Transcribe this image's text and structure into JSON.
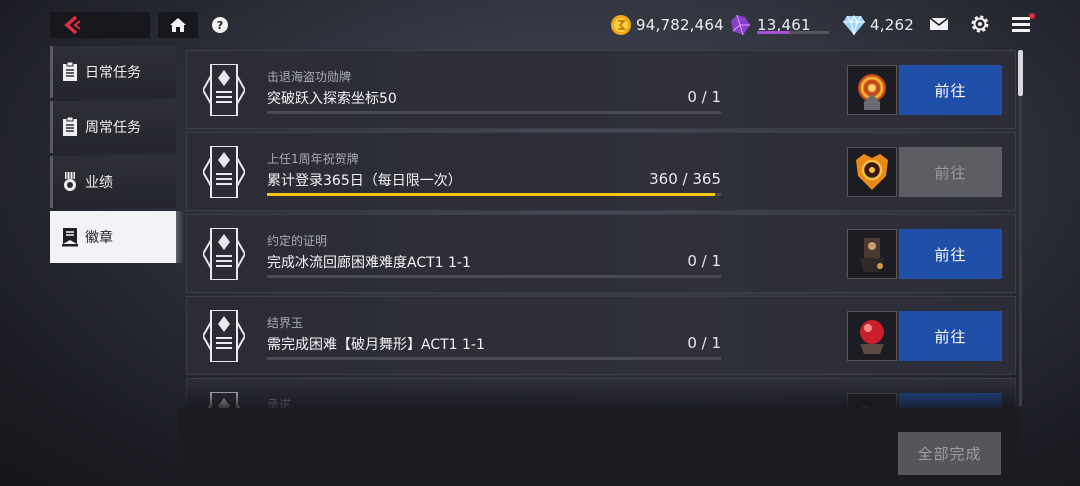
{
  "colors": {
    "accent_blue": "#1f4fa8",
    "progress_yellow": "#f5c518",
    "back_red": "#e03040",
    "purple": "#a44fd6",
    "disabled": "#5d5e64"
  },
  "topbar": {
    "back_icon": "back-chevron-icon",
    "home_icon": "home-icon",
    "help_icon": "help-icon",
    "help_glyph": "?",
    "gold": {
      "icon": "gold-coin-icon",
      "value": "94,782,464"
    },
    "purple": {
      "icon": "purple-crystal-icon",
      "value": "13,461",
      "progress": 0.45
    },
    "diamond": {
      "icon": "diamond-icon",
      "value": "4,262"
    },
    "mail_icon": "mail-icon",
    "settings_icon": "gear-icon",
    "menu_icon": "menu-icon"
  },
  "sidebar": {
    "items": [
      {
        "label": "日常任务",
        "icon": "clipboard-icon",
        "active": false
      },
      {
        "label": "周常任务",
        "icon": "clipboard-icon",
        "active": false
      },
      {
        "label": "业绩",
        "icon": "medal-icon",
        "active": false
      },
      {
        "label": "徽章",
        "icon": "badge-icon",
        "active": true
      }
    ]
  },
  "tasks": [
    {
      "category": "击退海盗功勋牌",
      "description": "突破跃入探索坐标50",
      "progress": "0 / 1",
      "fraction": 0,
      "button": "前往",
      "enabled": true
    },
    {
      "category": "上任1周年祝贺牌",
      "description": "累计登录365日（每日限一次）",
      "progress": "360 / 365",
      "fraction": 0.986,
      "button": "前往",
      "enabled": false
    },
    {
      "category": "约定的证明",
      "description": "完成冰流回廊困难难度ACT1 1-1",
      "progress": "0 / 1",
      "fraction": 0,
      "button": "前往",
      "enabled": true
    },
    {
      "category": "结界玉",
      "description": "需完成困难【破月舞形】ACT1 1-1",
      "progress": "0 / 1",
      "fraction": 0,
      "button": "前往",
      "enabled": true
    },
    {
      "category": "承诺",
      "description": "",
      "progress": "",
      "fraction": 0,
      "button": "",
      "enabled": true
    }
  ],
  "footer": {
    "complete_all": "全部完成"
  }
}
